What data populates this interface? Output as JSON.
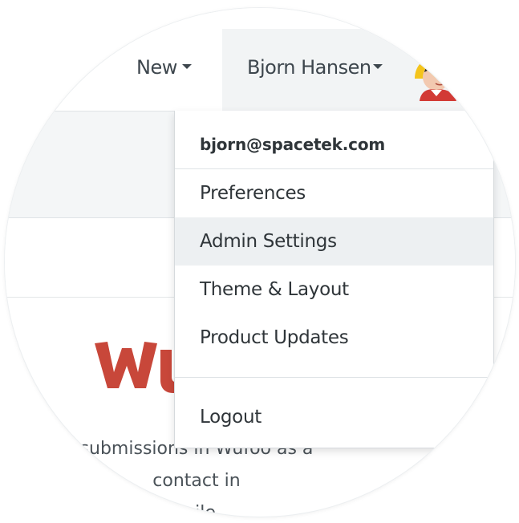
{
  "navbar": {
    "new_label": "New",
    "user_name": "Bjorn Hansen"
  },
  "dropdown": {
    "email": "bjorn@spacetek.com",
    "items": [
      {
        "label": "Preferences"
      },
      {
        "label": "Admin Settings",
        "active": true
      },
      {
        "label": "Theme & Layout"
      },
      {
        "label": "Product Updates"
      }
    ],
    "logout_label": "Logout"
  },
  "content": {
    "description_line1": "submissions in Wufoo as a contact in",
    "description_line2": "Agile."
  },
  "colors": {
    "hover_bg": "#edf0f2",
    "nav_user_bg": "#f2f4f5",
    "text": "#2f3539",
    "logo_red": "#c8473a"
  }
}
